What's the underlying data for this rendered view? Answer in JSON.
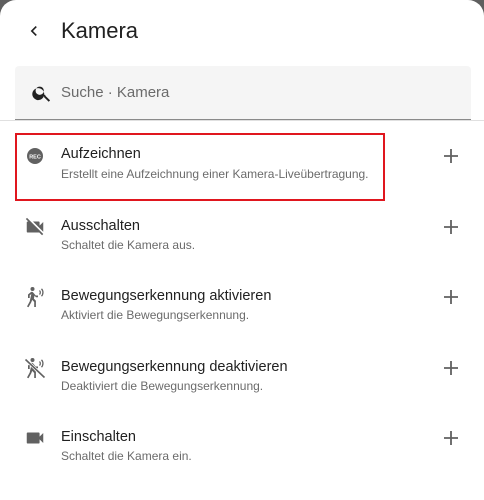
{
  "header": {
    "title": "Kamera"
  },
  "search": {
    "placeholder": "Suche · Kamera"
  },
  "items": [
    {
      "title": "Aufzeichnen",
      "subtitle": "Erstellt eine Aufzeichnung einer Kamera-Liveübertragung.",
      "icon": "record-icon"
    },
    {
      "title": "Ausschalten",
      "subtitle": "Schaltet die Kamera aus.",
      "icon": "video-off-icon"
    },
    {
      "title": "Bewegungserkennung aktivieren",
      "subtitle": "Aktiviert die Bewegungserkennung.",
      "icon": "motion-sensor-icon"
    },
    {
      "title": "Bewegungserkennung deaktivieren",
      "subtitle": "Deaktiviert die Bewegungserkennung.",
      "icon": "motion-sensor-off-icon"
    },
    {
      "title": "Einschalten",
      "subtitle": "Schaltet die Kamera ein.",
      "icon": "video-icon"
    }
  ],
  "colors": {
    "highlight": "#e0161e",
    "icon": "#616161",
    "text_primary": "#212121",
    "text_secondary": "#6b6b6b"
  }
}
